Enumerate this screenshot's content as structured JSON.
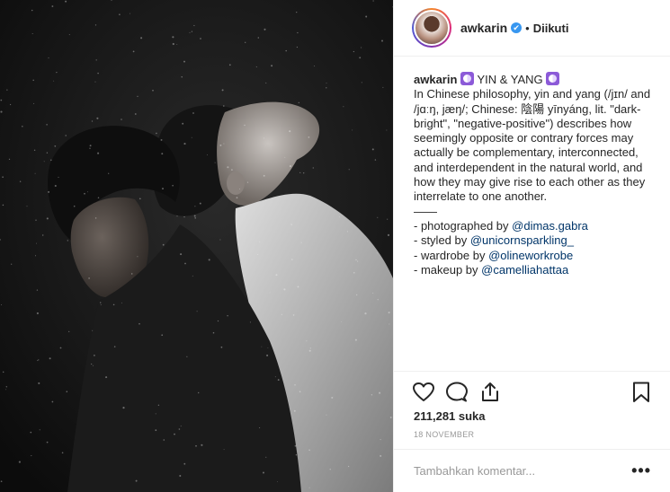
{
  "post": {
    "username": "awkarin",
    "verified_mark": "✔",
    "separator": "•",
    "follow_status": "Diikuti",
    "caption_title": "YIN & YANG",
    "caption_lines": [
      "In Chinese philosophy, yin and yang (/jɪn/ and",
      "/jɑːŋ, jæŋ/; Chinese: 陰陽 yīnyáng, lit. \"dark-",
      "bright\", \"negative-positive\") describes how",
      "seemingly opposite or contrary forces may",
      "actually be complementary, interconnected,",
      "and interdependent in the natural world, and",
      "how they may give rise to each other as they",
      "interrelate to one another."
    ],
    "divider_text": "——",
    "credits": [
      {
        "prefix": "- photographed by ",
        "mention": "@dimas.gabra"
      },
      {
        "prefix": "- styled by ",
        "mention": "@unicornsparkling_"
      },
      {
        "prefix": "- wardrobe by ",
        "mention": "@olineworkrobe"
      },
      {
        "prefix": "- makeup by ",
        "mention": "@camelliahattaa"
      }
    ],
    "likes": "211,281 suka",
    "date": "18 NOVEMBER",
    "comment_placeholder": "Tambahkan komentar...",
    "more_label": "•••"
  },
  "icons": [
    "heart-icon",
    "comment-icon",
    "share-icon",
    "bookmark-icon",
    "yin-yang-emoji"
  ],
  "colors": {
    "accent": "#3897f0",
    "mention": "#003569",
    "emoji": "#8c5ad8",
    "photo_bg": "#141414"
  }
}
